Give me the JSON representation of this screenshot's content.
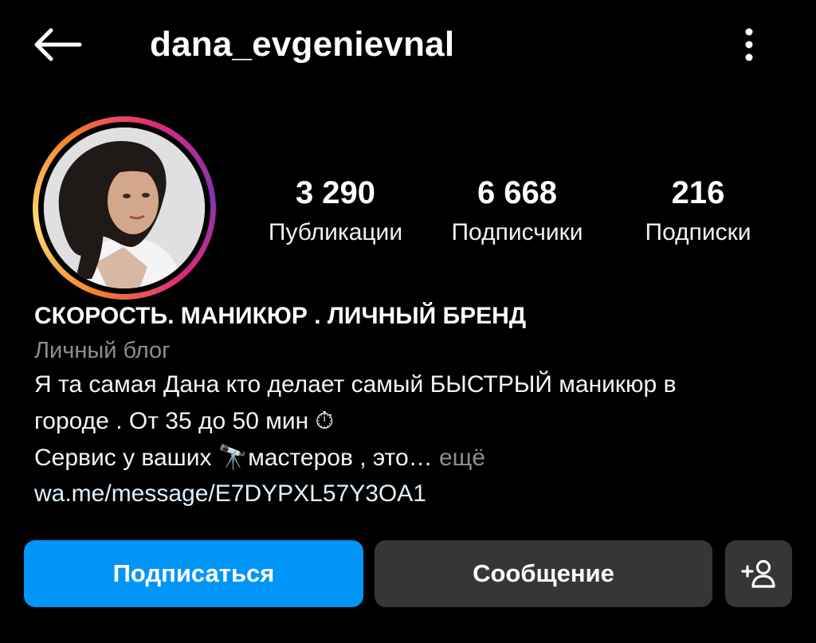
{
  "header": {
    "username": "dana_evgenievnal",
    "back_icon": "arrow-left-icon",
    "more_icon": "vertical-dots-icon"
  },
  "stats": {
    "posts_count": "3 290",
    "posts_label": "Публикации",
    "followers_count": "6 668",
    "followers_label": "Подписчики",
    "following_count": "216",
    "following_label": "Подписки"
  },
  "bio": {
    "name": "СКОРОСТЬ. МАНИКЮР . ЛИЧНЫЙ БРЕНД",
    "category": "Личный блог",
    "line1": "Я та самая Дана кто делает самый БЫСТРЫЙ маникюр в",
    "line2": "городе . От 35 до 50 мин ⏱",
    "line3": "Сервис у ваших 🔭мастеров , это…",
    "more_label": " ещё",
    "link": "wa.me/message/E7DYPXL57Y3OA1"
  },
  "actions": {
    "follow_label": "Подписаться",
    "message_label": "Сообщение",
    "suggest_icon": "add-person-icon"
  },
  "colors": {
    "background": "#000000",
    "follow_button": "#0095f6",
    "secondary_button": "#363636",
    "muted_text": "#8e8e8e"
  }
}
